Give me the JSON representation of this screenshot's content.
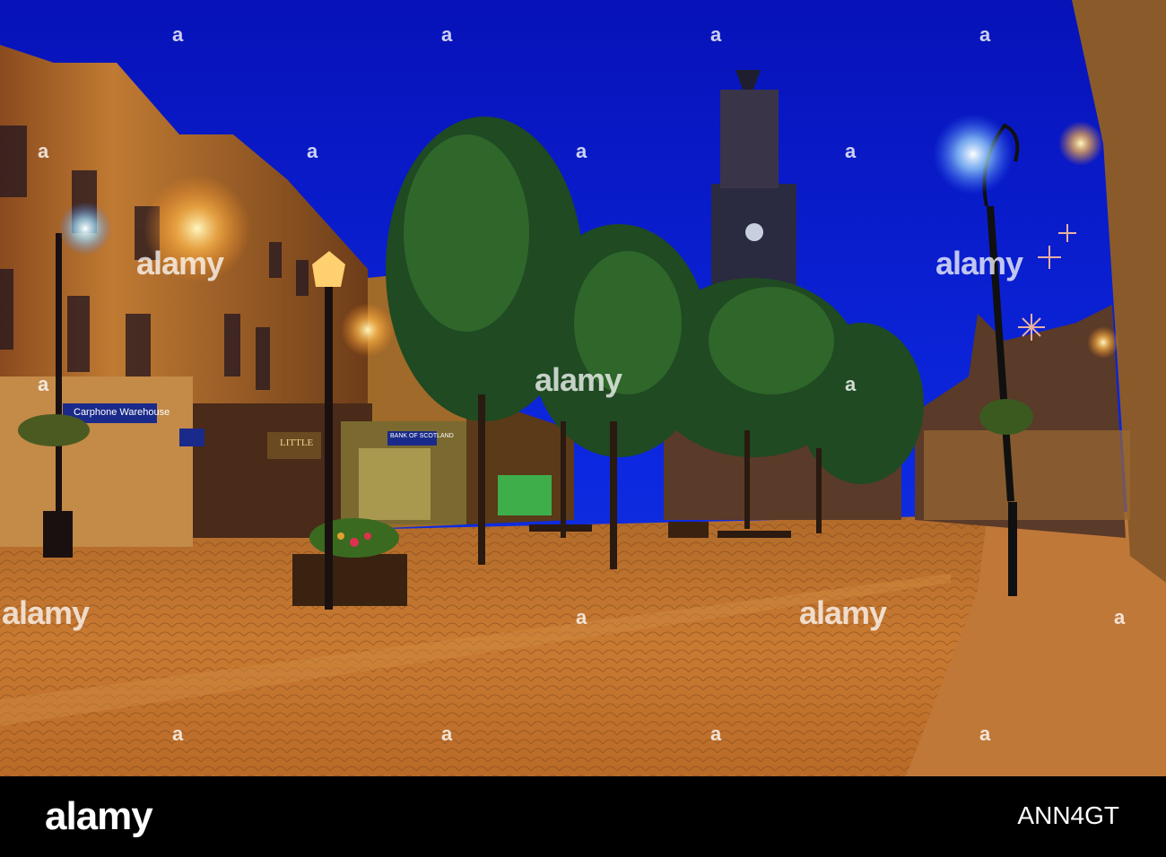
{
  "photo": {
    "signs": {
      "carphone": "Carphone Warehouse",
      "little": "LITTLE",
      "bank": "BANK OF SCOTLAND"
    }
  },
  "watermark": {
    "text": "alamy",
    "mark": "a"
  },
  "footer": {
    "logo": "alamy",
    "image_id": "ANN4GT"
  },
  "colors": {
    "sky": "#0a1ad8",
    "cobbles": "#c8752a",
    "lamp": "#bfe8ff"
  }
}
